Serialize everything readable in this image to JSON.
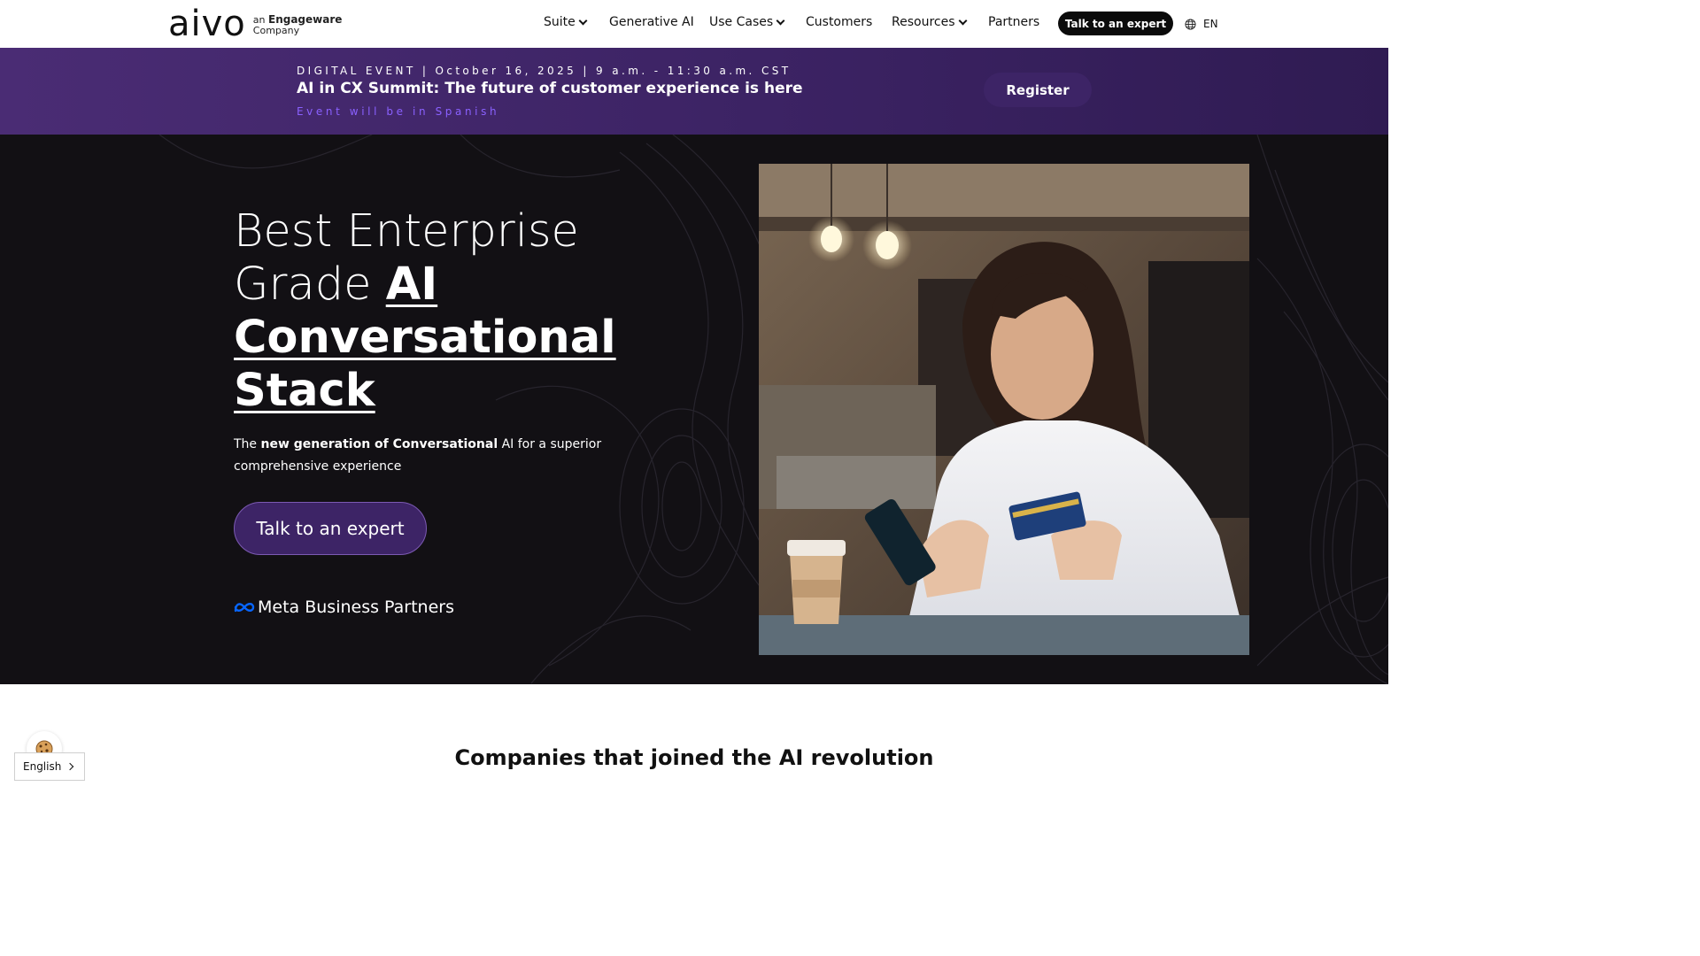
{
  "header": {
    "logo_text": "aivo",
    "logo_sub_prefix": "an",
    "logo_sub_brand": "Engageware",
    "logo_sub_suffix": "Company",
    "nav": [
      {
        "label": "Suite",
        "has_dropdown": true
      },
      {
        "label": "Generative AI",
        "has_dropdown": false
      },
      {
        "label": "Use Cases",
        "has_dropdown": true
      },
      {
        "label": "Customers",
        "has_dropdown": false
      },
      {
        "label": "Resources",
        "has_dropdown": true
      },
      {
        "label": "Partners",
        "has_dropdown": false
      }
    ],
    "cta_label": "Talk to an expert",
    "language": "EN",
    "language_icon": "globe-icon"
  },
  "banner": {
    "meta": "DIGITAL EVENT | October 16, 2025 | 9 a.m. - 11:30 a.m. CST",
    "title": "AI in CX Summit: The future of customer experience is here",
    "note": "Event will be in Spanish",
    "register_label": "Register"
  },
  "hero": {
    "title_line1": "Best Enterprise",
    "title_line2_light": "Grade",
    "title_line2_bold": "AI",
    "title_line3": "Conversational",
    "title_line4": "Stack",
    "desc_part1": "The ",
    "desc_bold": "new generation of Conversational",
    "desc_part2": " AI for a superior comprehensive experience",
    "cta_label": "Talk to an expert",
    "partner_label": "Meta Business Partners",
    "partner_icon": "meta-infinity-icon"
  },
  "companies": {
    "heading": "Companies that joined the AI revolution"
  },
  "language_switcher": {
    "label": "English"
  },
  "colors": {
    "banner_bg": "#3c2364",
    "hero_bg": "#121014",
    "cta_purple": "#3d2466",
    "accent_violet": "#8a61ff",
    "meta_blue": "#0866ff"
  }
}
